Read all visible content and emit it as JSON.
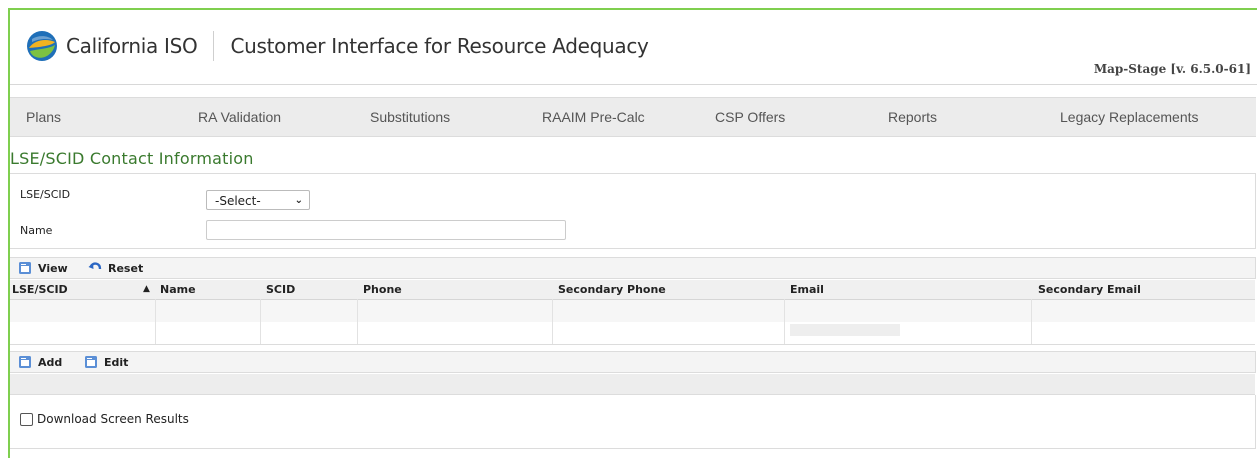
{
  "header": {
    "org": "California ISO",
    "app_title": "Customer Interface for Resource Adequacy",
    "version": "Map-Stage [v. 6.5.0-61]"
  },
  "nav": {
    "items": [
      {
        "label": "Plans"
      },
      {
        "label": "RA Validation"
      },
      {
        "label": "Substitutions"
      },
      {
        "label": "RAAIM Pre-Calc"
      },
      {
        "label": "CSP Offers"
      },
      {
        "label": "Reports"
      },
      {
        "label": "Legacy Replacements"
      }
    ]
  },
  "page": {
    "title": "LSE/SCID Contact Information"
  },
  "search": {
    "lse_label": "LSE/SCID",
    "lse_value": "-Select-",
    "name_label": "Name",
    "name_value": ""
  },
  "toolbar_top": {
    "view_label": "View",
    "reset_label": "Reset"
  },
  "grid": {
    "columns": [
      "LSE/SCID",
      "Name",
      "SCID",
      "Phone",
      "Secondary Phone",
      "Email",
      "Secondary Email"
    ],
    "sort_indicator": "▲"
  },
  "toolbar_bottom": {
    "add_label": "Add",
    "edit_label": "Edit"
  },
  "download": {
    "label": "Download Screen Results",
    "checked": false
  },
  "colors": {
    "accent_green": "#7fcf4f",
    "title_green": "#3a7a2e"
  }
}
